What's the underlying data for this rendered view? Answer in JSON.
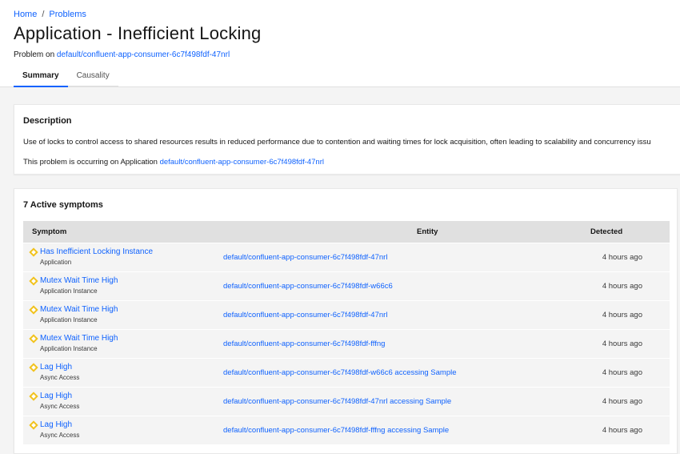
{
  "breadcrumb": {
    "home": "Home",
    "separator": "/",
    "problems": "Problems"
  },
  "page": {
    "title": "Application - Inefficient Locking",
    "subtitle_prefix": "Problem on",
    "subtitle_link": "default/confluent-app-consumer-6c7f498fdf-47nrl"
  },
  "tabs": [
    {
      "label": "Summary",
      "active": true
    },
    {
      "label": "Causality",
      "active": false
    }
  ],
  "description": {
    "heading": "Description",
    "text": "Use of locks to control access to shared resources results in reduced performance due to contention and waiting times for lock acquisition, often leading to scalability and concurrency issu",
    "occurring_prefix": "This problem is occurring on Application",
    "occurring_link": "default/confluent-app-consumer-6c7f498fdf-47nrl"
  },
  "symptoms": {
    "heading": "7 Active symptoms",
    "columns": {
      "symptom": "Symptom",
      "entity": "Entity",
      "detected": "Detected"
    },
    "rows": [
      {
        "name": "Has Inefficient Locking Instance",
        "type": "Application",
        "entity": "default/confluent-app-consumer-6c7f498fdf-47nrl",
        "detected": "4 hours ago"
      },
      {
        "name": "Mutex Wait Time High",
        "type": "Application Instance",
        "entity": "default/confluent-app-consumer-6c7f498fdf-w66c6",
        "detected": "4 hours ago"
      },
      {
        "name": "Mutex Wait Time High",
        "type": "Application Instance",
        "entity": "default/confluent-app-consumer-6c7f498fdf-47nrl",
        "detected": "4 hours ago"
      },
      {
        "name": "Mutex Wait Time High",
        "type": "Application Instance",
        "entity": "default/confluent-app-consumer-6c7f498fdf-fffng",
        "detected": "4 hours ago"
      },
      {
        "name": "Lag High",
        "type": "Async Access",
        "entity": "default/confluent-app-consumer-6c7f498fdf-w66c6 accessing Sample",
        "detected": "4 hours ago"
      },
      {
        "name": "Lag High",
        "type": "Async Access",
        "entity": "default/confluent-app-consumer-6c7f498fdf-47nrl accessing Sample",
        "detected": "4 hours ago"
      },
      {
        "name": "Lag High",
        "type": "Async Access",
        "entity": "default/confluent-app-consumer-6c7f498fdf-fffng accessing Sample",
        "detected": "4 hours ago"
      }
    ]
  },
  "colors": {
    "link": "#0f62fe",
    "warning_icon": "#f1c21b",
    "tab_active": "#0f62fe"
  },
  "icons": {
    "symptom": "warning-diamond-icon"
  }
}
